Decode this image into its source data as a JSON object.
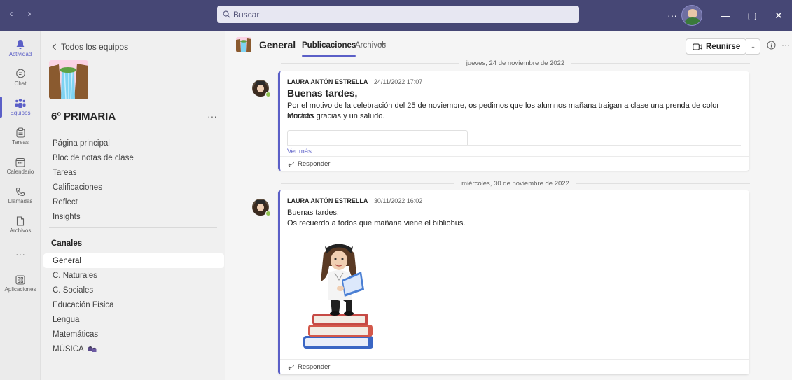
{
  "titlebar": {
    "back_arrow": "‹",
    "forward_arrow": "›",
    "search_placeholder": "Buscar",
    "more": "···",
    "minimize": "—",
    "maximize": "▢",
    "close": "✕"
  },
  "rail": {
    "items": [
      {
        "label": "Actividad",
        "icon": "bell-icon",
        "active": false
      },
      {
        "label": "Chat",
        "icon": "chat-icon",
        "active": false
      },
      {
        "label": "Equipos",
        "icon": "teams-icon",
        "active": true
      },
      {
        "label": "Tareas",
        "icon": "assignments-icon",
        "active": false
      },
      {
        "label": "Calendario",
        "icon": "calendar-icon",
        "active": false
      },
      {
        "label": "Llamadas",
        "icon": "phone-icon",
        "active": false
      },
      {
        "label": "Archivos",
        "icon": "file-icon",
        "active": false
      },
      {
        "label": "",
        "icon": "more-icon",
        "active": false
      },
      {
        "label": "Aplicaciones",
        "icon": "apps-icon",
        "active": false
      }
    ],
    "more_label": "···"
  },
  "team": {
    "back_label": "Todos los equipos",
    "name": "6º PRIMARIA",
    "more": "···",
    "tabs": [
      "Página principal",
      "Bloc de notas de clase",
      "Tareas",
      "Calificaciones",
      "Reflect",
      "Insights"
    ],
    "channels_heading": "Canales",
    "channels": [
      "General",
      "C. Naturales",
      "C. Sociales",
      "Educación Física",
      "Lengua",
      "Matemáticas",
      "MÚSICA"
    ],
    "selected_channel": "General"
  },
  "channel_header": {
    "title": "General",
    "tabs": [
      "Publicaciones",
      "Archivos"
    ],
    "active_tab": "Publicaciones",
    "add": "+",
    "meet_label": "Reunirse",
    "caret": "⌄",
    "more": "···"
  },
  "posts": [
    {
      "date_separator": "jueves, 24 de noviembre de 2022",
      "author": "LAURA ANTÓN ESTRELLA",
      "timestamp": "24/11/2022 17:07",
      "subject": "Buenas tardes,",
      "body": [
        "Por el motivo de la celebración del 25 de noviembre, os pedimos que los alumnos mañana traigan a clase una prenda de color morado.",
        "Muchas gracias y un saludo."
      ],
      "see_more": "Ver más",
      "reply": "Responder"
    },
    {
      "date_separator": "miércoles, 30 de noviembre de 2022",
      "author": "LAURA ANTÓN ESTRELLA",
      "timestamp": "30/11/2022 16:02",
      "body": [
        "Buenas tardes,",
        "Os recuerdo a todos que mañana viene el bibliobús."
      ],
      "reply": "Responder"
    }
  ],
  "colors": {
    "titlebar": "#464775",
    "accent": "#5b5fc7",
    "presence": "#92c353"
  }
}
